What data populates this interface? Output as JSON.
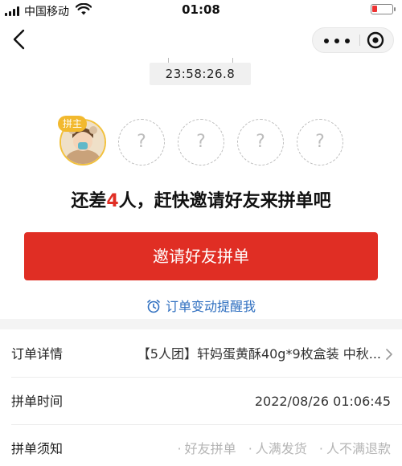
{
  "status_bar": {
    "carrier": "中国移动",
    "time": "01:08"
  },
  "countdown": "23:58:26.8",
  "group": {
    "host_badge": "拼主",
    "empty_slot_symbol": "?",
    "empty_slots": 4
  },
  "headline": {
    "prefix": "还差",
    "count": "4",
    "suffix": "人，赶快邀请好友来拼单吧"
  },
  "invite_button": "邀请好友拼单",
  "reminder_link": "订单变动提醒我",
  "rows": {
    "order_label": "订单详情",
    "order_value": "【5人团】轩妈蛋黄酥40g*9枚盒装 中秋...",
    "time_label": "拼单时间",
    "time_value": "2022/08/26 01:06:45",
    "notice_label": "拼单须知",
    "notice_tags": [
      "好友拼单",
      "人满发货",
      "人不满退款"
    ]
  },
  "colors": {
    "accent": "#e02e24",
    "link": "#2f6fc0",
    "host_border": "#f2c13c"
  },
  "icons": {
    "back": "back-arrow-icon",
    "more": "more-dots-icon",
    "close": "mini-program-close-icon",
    "alarm": "alarm-clock-icon",
    "chevron": "chevron-right-icon"
  }
}
